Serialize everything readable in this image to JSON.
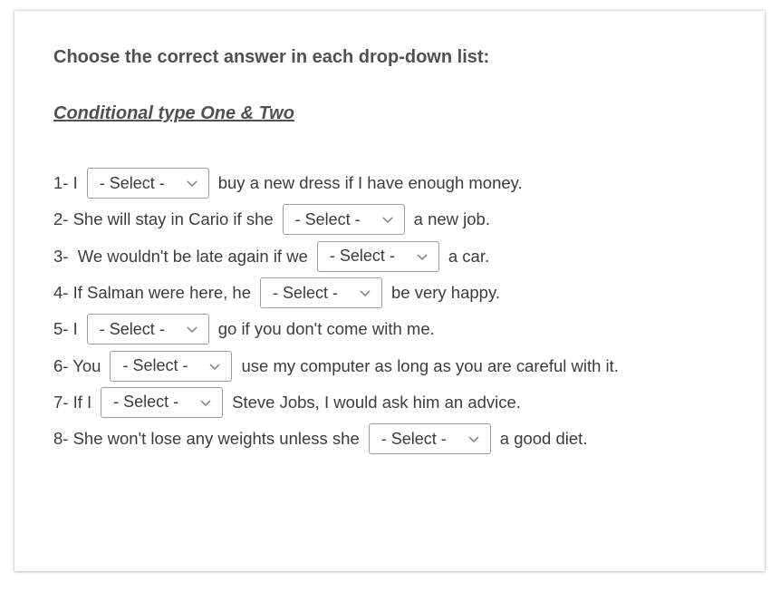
{
  "instructions": "Choose the correct answer in each drop-down list:",
  "subtitle": "Conditional type One & Two",
  "select_placeholder": "- Select -",
  "questions": [
    {
      "before": "1- I",
      "after": "buy a new dress if I have enough money."
    },
    {
      "before": "2- She will stay in Cario if she",
      "after": "a new job."
    },
    {
      "before": "3-  We wouldn't be late again if we",
      "after": "a car."
    },
    {
      "before": "4- If Salman were here, he",
      "after": "be very happy."
    },
    {
      "before": "5- I",
      "after": "go if you don't come with me."
    },
    {
      "before": "6- You",
      "after": "use my computer as long as you are careful with it."
    },
    {
      "before": "7- If I",
      "after": "Steve Jobs, I would ask him an advice."
    },
    {
      "before": "8- She won't lose any weights unless she",
      "after": "a good diet."
    }
  ],
  "colors": {
    "heading_text": "#505050",
    "body_text": "#3c3c3c",
    "select_border": "#9e9e9e"
  },
  "icons": {
    "select_arrow": "chevron-down-icon"
  }
}
